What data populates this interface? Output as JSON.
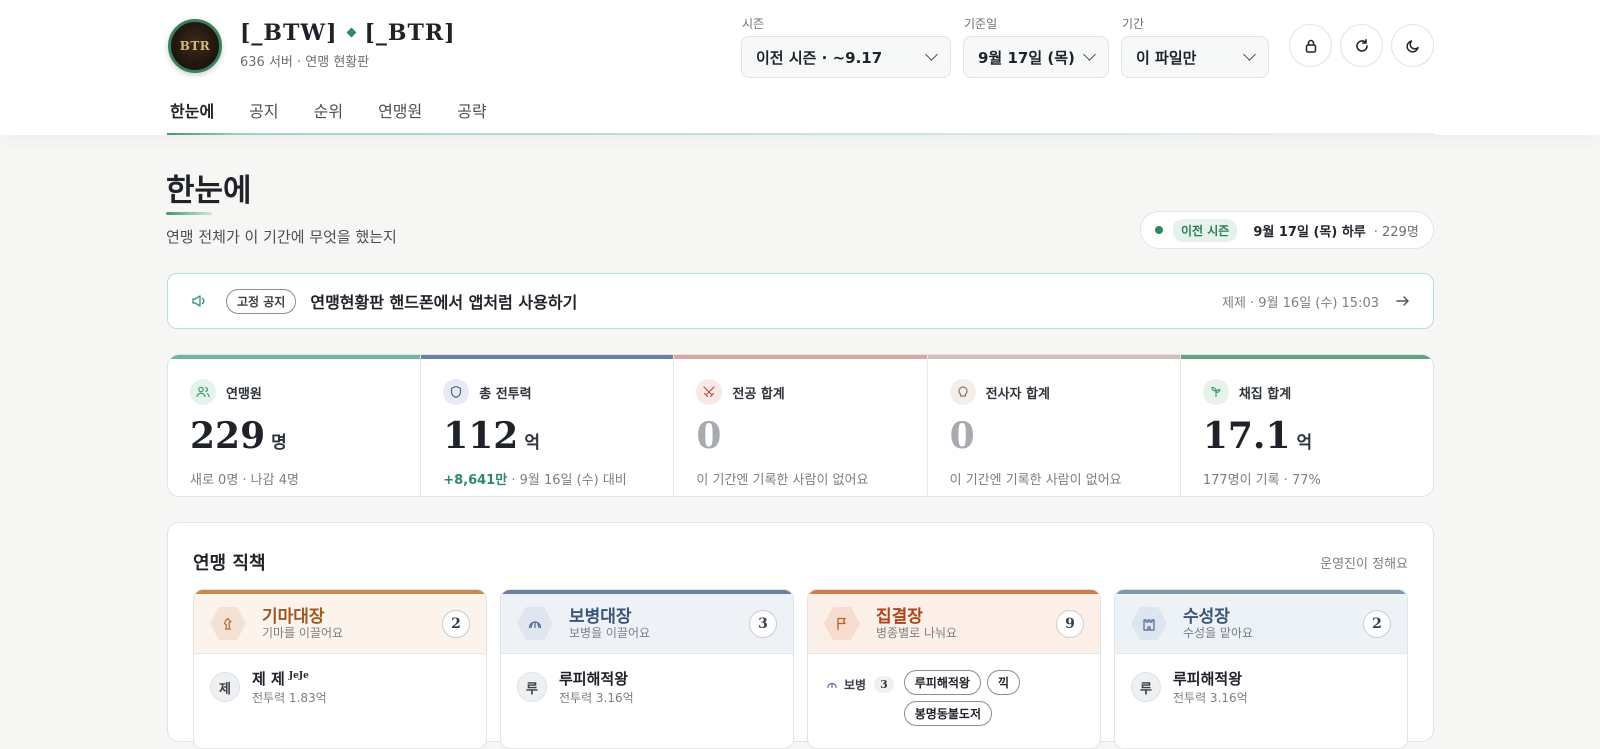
{
  "app": {
    "logo_text": "BTR",
    "brand_left": "[_BTW]",
    "brand_right": "[_BTR]",
    "subtitle": "636 서버 · 연맹 현황판"
  },
  "nav": {
    "tabs": [
      "한눈에",
      "공지",
      "순위",
      "연맹원",
      "공략"
    ],
    "active": "한눈에"
  },
  "filters": {
    "season": {
      "label": "시즌",
      "value": "이전 시즌 · ~9.17"
    },
    "base_date": {
      "label": "기준일",
      "value": "9월 17일 (목)"
    },
    "period": {
      "label": "기간",
      "value": "이 파일만"
    }
  },
  "header_icons": [
    "lock-icon",
    "refresh-icon",
    "moon-icon"
  ],
  "page": {
    "title": "한눈에",
    "description": "연맹 전체가 이 기간에 무엇을 했는지"
  },
  "period_pill": {
    "tag": "이전 시즌",
    "date": "9월 17일 (목) 하루",
    "count": "· 229명"
  },
  "notice": {
    "badge": "고정 공지",
    "text": "연맹현황판 핸드폰에서 앱처럼 사용하기",
    "meta": "제제 · 9월 16일 (수) 15:03"
  },
  "stats": [
    {
      "label": "연맹원",
      "value": "229",
      "unit": "명",
      "note": "새로 0명 · 나감 4명",
      "color": "#6fb79a",
      "icon": "users-icon"
    },
    {
      "label": "총 전투력",
      "value": "112",
      "unit": "억",
      "note_up": "+8,641만",
      "note": " · 9월 16일 (수) 대비",
      "color": "#6b7fa0",
      "icon": "shield-icon"
    },
    {
      "label": "전공 합계",
      "value": "0",
      "unit": "",
      "note": "이 기간엔 기록한 사람이 없어요",
      "color": "#d9a6a0",
      "icon": "swords-icon"
    },
    {
      "label": "전사자 합계",
      "value": "0",
      "unit": "",
      "note": "이 기간엔 기록한 사람이 없어요",
      "color": "#cfc2bd",
      "icon": "skull-icon"
    },
    {
      "label": "채집 합계",
      "value": "17.1",
      "unit": "억",
      "note": "177명이 기록 · 77%",
      "color": "#5fa383",
      "icon": "sprout-icon"
    }
  ],
  "roles_section": {
    "title": "연맹 직책",
    "note": "운영진이 정해요",
    "roles": [
      {
        "name": "기마대장",
        "desc": "기마를 이끌어요",
        "count": "2",
        "color": "#c98a4e",
        "icon": "horse-icon",
        "member": {
          "avatar": "제",
          "name": "제 제",
          "tag": "JeJe",
          "power": "전투력 1.83억"
        }
      },
      {
        "name": "보병대장",
        "desc": "보병을 이끌어요",
        "count": "3",
        "color": "#6b7fa0",
        "icon": "helmet-icon",
        "member": {
          "avatar": "루",
          "name": "루피해적왕",
          "power": "전투력 3.16억"
        }
      },
      {
        "name": "집결장",
        "desc": "병종별로 나눠요",
        "count": "9",
        "color": "#d27a4a",
        "icon": "flag-icon",
        "sub": {
          "label": "보병",
          "count": "3",
          "chips": [
            "루피해적왕",
            "끽",
            "봉명동불도저"
          ]
        }
      },
      {
        "name": "수성장",
        "desc": "수성을 맡아요",
        "count": "2",
        "color": "#7f96b0",
        "icon": "castle-icon",
        "member": {
          "avatar": "루",
          "name": "루피해적왕",
          "power": "전투력 3.16억"
        }
      }
    ]
  }
}
